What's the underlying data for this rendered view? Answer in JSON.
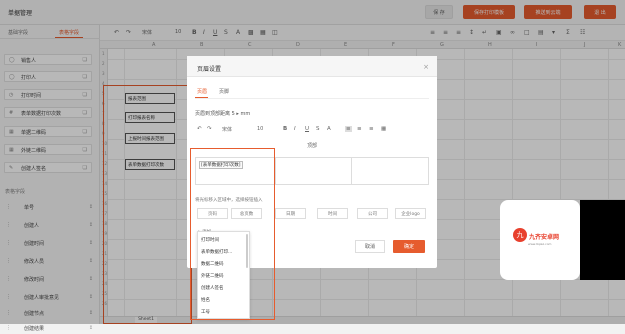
{
  "app": {
    "title": "单据管理"
  },
  "top_buttons": {
    "b1": "保 存",
    "b2": "保存打印模板",
    "b3": "推送到云端",
    "b4": "退 出"
  },
  "left": {
    "tab_base": "基础字段",
    "tab_custom": "表格字段",
    "fields": [
      {
        "label": "销售人"
      },
      {
        "label": "打印人"
      },
      {
        "label": "打印时间"
      },
      {
        "label": "表单数据打印次数"
      },
      {
        "label": "单据二维码"
      },
      {
        "label": "外链二维码"
      },
      {
        "label": "创建人签名"
      }
    ],
    "form_section_title": "表格字段",
    "form_fields": [
      {
        "label": "单号"
      },
      {
        "label": "创建人"
      },
      {
        "label": "创建时间"
      },
      {
        "label": "修改人员"
      },
      {
        "label": "修改时间"
      },
      {
        "label": "创建人审批意见"
      },
      {
        "label": "创建节点"
      },
      {
        "label": "创建结果"
      }
    ]
  },
  "toolbar": {
    "font": "宋体",
    "size": "10"
  },
  "sheet": {
    "columns": [
      "A",
      "B",
      "C",
      "D",
      "E",
      "F",
      "G",
      "H",
      "I",
      "J",
      "K"
    ],
    "rows": [
      "1",
      "2",
      "3",
      "4",
      "5",
      "6",
      "7",
      "8",
      "9",
      "10",
      "11",
      "12",
      "13",
      "14",
      "15",
      "16",
      "17",
      "18",
      "19",
      "20",
      "21",
      "22",
      "23",
      "24",
      "25",
      "26"
    ],
    "cells": [
      {
        "text": "报表范围"
      },
      {
        "text": "打印报表名称"
      },
      {
        "text": "上报时间报表范围"
      },
      {
        "text": "表单数据打印次数"
      }
    ],
    "tab": "Sheet1"
  },
  "dialog": {
    "title": "页眉设置",
    "tab_header": "页眉",
    "tab_footer": "页脚",
    "margin_label": "页眉到顶部距离 5 ▸ mm",
    "editor_font": "宋体",
    "editor_size": "10",
    "top_label": "顶部",
    "editor_content": "[表单数据打印次数]",
    "hint": "将光标移入区域中，选择按钮插入",
    "insert_buttons": [
      "页码",
      "总页数",
      "日期",
      "时间",
      "公司",
      "企业logo"
    ],
    "add_field": "+ 添加",
    "cancel": "取消",
    "ok": "确定",
    "dropdown": [
      "打印时间",
      "表单数据打印...",
      "数据二维码",
      "外链二维码",
      "创建人签名",
      "姓名",
      "工号"
    ]
  },
  "watermark": {
    "logo_char": "九",
    "name": "九齐安卓网",
    "sub": "www.9qiaz.com"
  }
}
